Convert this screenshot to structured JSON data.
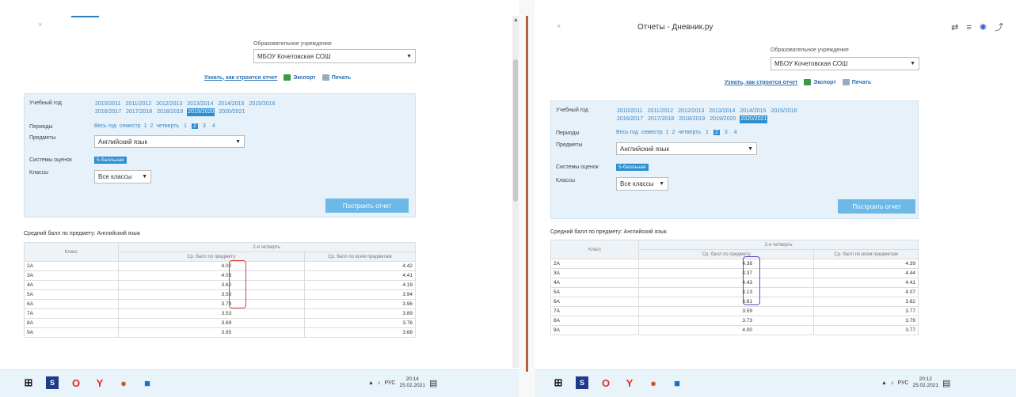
{
  "left": {
    "org_label": "Образовательное учреждение",
    "org_value": "МБОУ Кочетовская СОШ",
    "links": {
      "how": "Узнать, как строится отчет",
      "export": "Экспорт",
      "print": "Печать"
    },
    "filters": {
      "year_label": "Учебный год",
      "years_row1": [
        "2010/2011",
        "2011/2012",
        "2012/2013",
        "2013/2014",
        "2014/2015",
        "2015/2016"
      ],
      "years_row2": [
        "2016/2017",
        "2017/2018",
        "2018/2019",
        "2019/2020",
        "2020/2021"
      ],
      "selected_year": "2019/2020",
      "periods_label": "Периоды",
      "period_all": "Весь год",
      "period_semester": "семестр",
      "period_quarter": "четверть",
      "quarters": [
        "1",
        "2",
        "3",
        "4"
      ],
      "selected_quarter": "2",
      "subjects_label": "Предметы",
      "subject_value": "Английский язык",
      "grading_label": "Системы оценок",
      "grading_value": "5-балльная",
      "classes_label": "Классы",
      "classes_value": "Все классы",
      "build_button": "Построить отчет"
    },
    "table": {
      "caption": "Средний балл по предмету: Английский язык",
      "col_class": "Класс",
      "col_period": "2-я четверть",
      "col_subject": "Ср. балл по предмету",
      "col_all": "Ср. балл по всем предметам",
      "rows": [
        {
          "cls": "2А",
          "subj": "4.02",
          "all": "4.42"
        },
        {
          "cls": "3А",
          "subj": "4.03",
          "all": "4.41"
        },
        {
          "cls": "4А",
          "subj": "3.62",
          "all": "4.19"
        },
        {
          "cls": "5А",
          "subj": "3.53",
          "all": "3.94"
        },
        {
          "cls": "6А",
          "subj": "3.74",
          "all": "3.96"
        },
        {
          "cls": "7А",
          "subj": "3.53",
          "all": "3.89"
        },
        {
          "cls": "8А",
          "subj": "3.69",
          "all": "3.76"
        },
        {
          "cls": "9А",
          "subj": "3.65",
          "all": "3.68"
        }
      ]
    },
    "tray": {
      "lang": "РУС",
      "time": "20:14",
      "date": "25.02.2021"
    }
  },
  "right": {
    "window_title": "Отчеты - Дневник.ру",
    "org_label": "Образовательное учреждение",
    "org_value": "МБОУ Кочетовская СОШ",
    "links": {
      "how": "Узнать, как строится отчет",
      "export": "Экспорт",
      "print": "Печать"
    },
    "filters": {
      "year_label": "Учебный год",
      "years_row1": [
        "2010/2011",
        "2011/2012",
        "2012/2013",
        "2013/2014",
        "2014/2015",
        "2015/2016"
      ],
      "years_row2": [
        "2016/2017",
        "2017/2018",
        "2018/2019",
        "2019/2020",
        "2020/2021"
      ],
      "selected_year": "2020/2021",
      "periods_label": "Периоды",
      "period_all": "Весь год",
      "period_semester": "семестр",
      "period_quarter": "четверть",
      "quarters": [
        "1",
        "2",
        "3",
        "4"
      ],
      "selected_quarter": "2",
      "subjects_label": "Предметы",
      "subject_value": "Английский язык",
      "grading_label": "Системы оценок",
      "grading_value": "5-балльная",
      "classes_label": "Классы",
      "classes_value": "Все классы",
      "build_button": "Построить отчет"
    },
    "table": {
      "caption": "Средний балл по предмету: Английский язык",
      "col_class": "Класс",
      "col_period": "2-я четверть",
      "col_subject": "Ср. балл по предмету",
      "col_all": "Ср. балл по всем предметам",
      "rows": [
        {
          "cls": "2А",
          "subj": "4.38",
          "all": "4.39"
        },
        {
          "cls": "3А",
          "subj": "4.37",
          "all": "4.44"
        },
        {
          "cls": "4А",
          "subj": "4.43",
          "all": "4.41"
        },
        {
          "cls": "5А",
          "subj": "4.13",
          "all": "4.07"
        },
        {
          "cls": "6А",
          "subj": "3.81",
          "all": "3.82"
        },
        {
          "cls": "7А",
          "subj": "3.59",
          "all": "3.77"
        },
        {
          "cls": "8А",
          "subj": "3.73",
          "all": "3.79"
        },
        {
          "cls": "9А",
          "subj": "4.00",
          "all": "3.77"
        }
      ]
    },
    "tray": {
      "lang": "РУС",
      "time": "20:12",
      "date": "25.02.2021"
    }
  },
  "colors": {
    "accent": "#2b8fd1",
    "left_highlight": "#e0403a",
    "right_highlight": "#5a4fc8",
    "divider": "#b5603a"
  },
  "icons": [
    "chrome-like-icon",
    "skype-icon",
    "opera-icon",
    "yandex-icon",
    "app-icon",
    "mail-icon",
    "network-icon",
    "volume-icon"
  ]
}
